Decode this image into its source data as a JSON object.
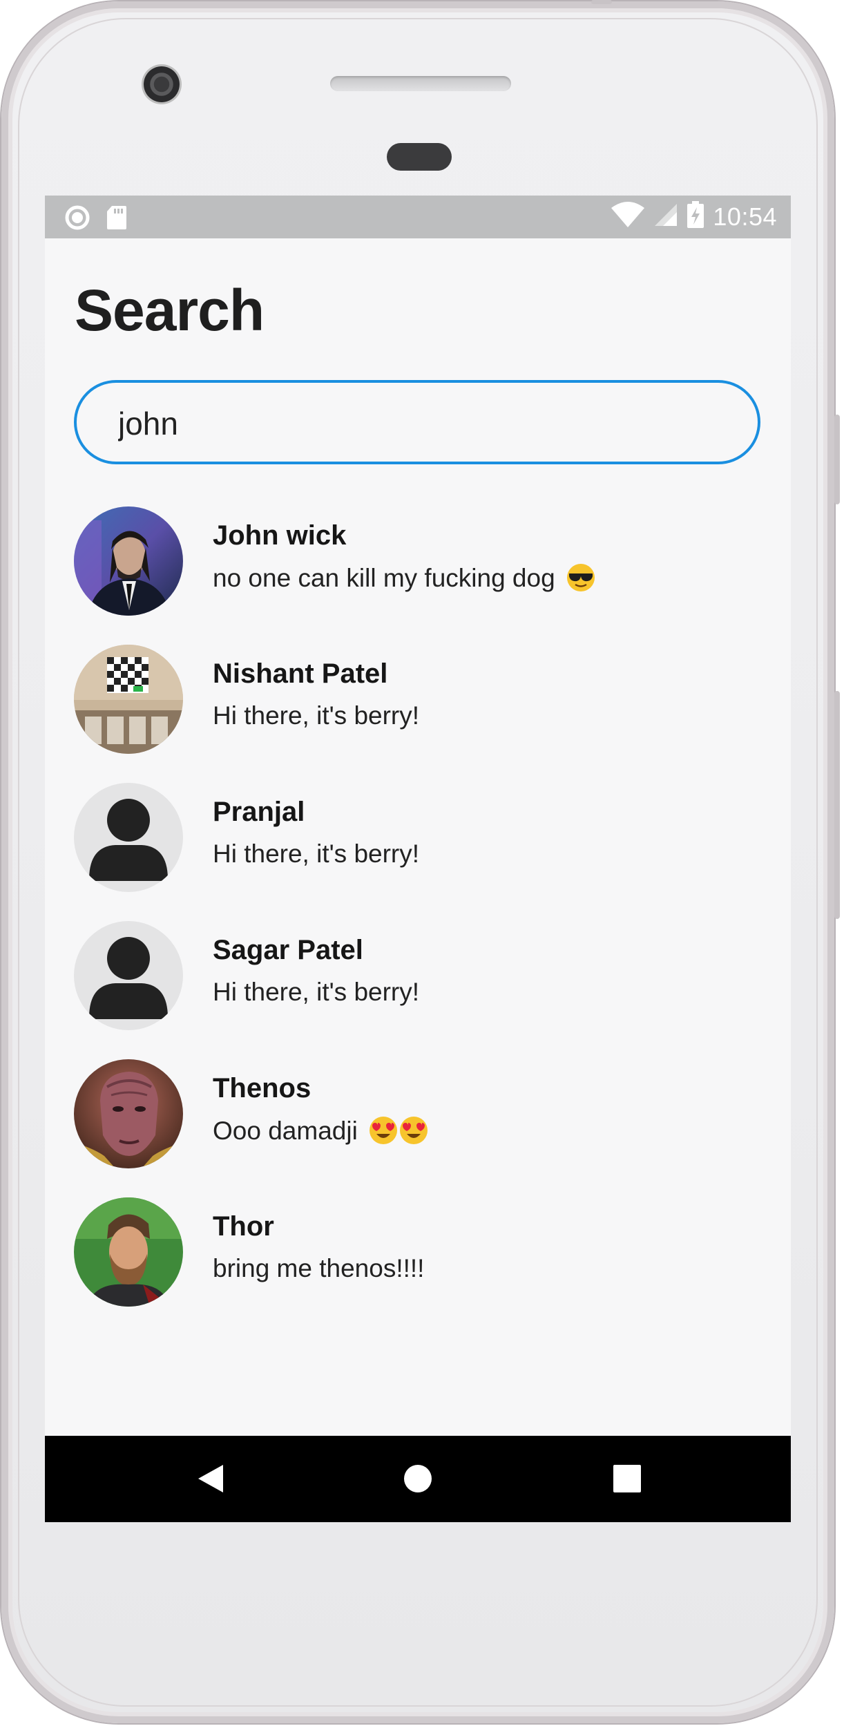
{
  "status_bar": {
    "time": "10:54",
    "left_icons": [
      "circle-notification-icon",
      "sd-card-icon"
    ],
    "right_icons": [
      "wifi-icon",
      "cell-signal-icon",
      "battery-charging-icon"
    ]
  },
  "page": {
    "title": "Search"
  },
  "search": {
    "value": "john"
  },
  "contacts": [
    {
      "name": "John wick",
      "message": "no one can kill my fucking dog",
      "emoji": [
        "sunglasses"
      ],
      "avatar": "photo"
    },
    {
      "name": "Nishant Patel",
      "message": "Hi there, it's berry!",
      "emoji": [],
      "avatar": "photo"
    },
    {
      "name": "Pranjal",
      "message": "Hi there, it's berry!",
      "emoji": [],
      "avatar": "placeholder"
    },
    {
      "name": "Sagar Patel",
      "message": "Hi there, it's berry!",
      "emoji": [],
      "avatar": "placeholder"
    },
    {
      "name": "Thenos",
      "message": "Ooo damadji",
      "emoji": [
        "heart-eyes",
        "heart-eyes"
      ],
      "avatar": "photo"
    },
    {
      "name": "Thor",
      "message": "bring me thenos!!!!",
      "emoji": [],
      "avatar": "photo"
    }
  ],
  "nav_bar": {
    "buttons": [
      "back-icon",
      "home-icon",
      "recents-icon"
    ]
  },
  "colors": {
    "accent": "#1a8fe0",
    "status_bar": "#bdbebf",
    "screen_bg": "#f7f7f8",
    "nav_bar": "#000000"
  }
}
